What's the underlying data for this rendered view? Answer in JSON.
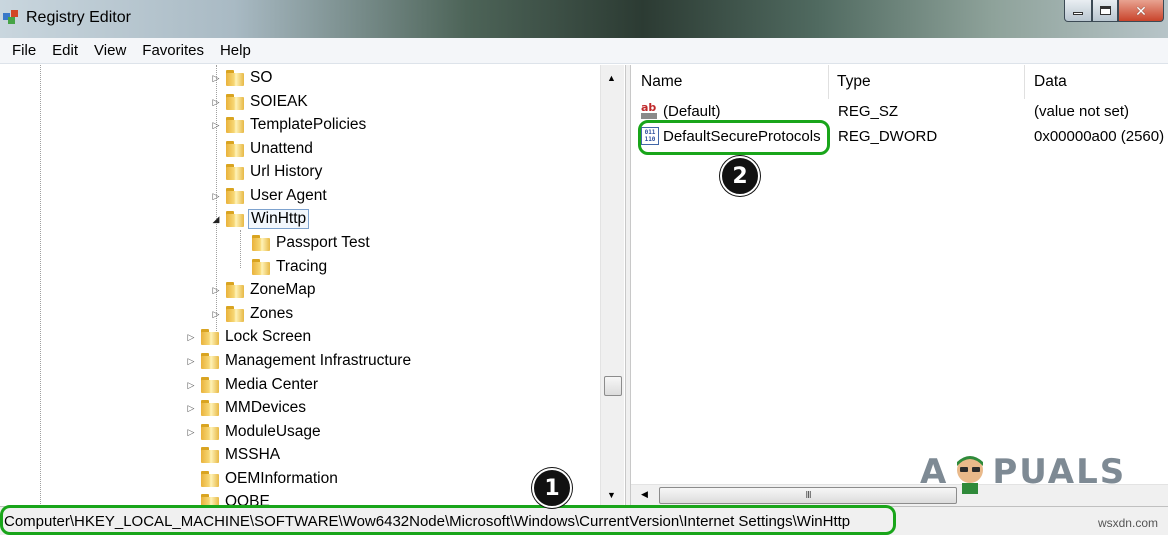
{
  "window": {
    "title": "Registry Editor",
    "controls": {
      "minimize": "—",
      "maximize": "□",
      "close": "✕"
    }
  },
  "menu": [
    "File",
    "Edit",
    "View",
    "Favorites",
    "Help"
  ],
  "tree": {
    "items": [
      {
        "label": "SO",
        "expander": "▷"
      },
      {
        "label": "SOIEAK",
        "expander": "▷"
      },
      {
        "label": "TemplatePolicies",
        "expander": "▷"
      },
      {
        "label": "Unattend",
        "expander": ""
      },
      {
        "label": "Url History",
        "expander": ""
      },
      {
        "label": "User Agent",
        "expander": "▷"
      },
      {
        "label": "WinHttp",
        "expander": "◢"
      },
      {
        "label": "Passport Test",
        "expander": ""
      },
      {
        "label": "Tracing",
        "expander": ""
      },
      {
        "label": "ZoneMap",
        "expander": "▷"
      },
      {
        "label": "Zones",
        "expander": "▷"
      },
      {
        "label": "Lock Screen",
        "expander": "▷"
      },
      {
        "label": "Management Infrastructure",
        "expander": "▷"
      },
      {
        "label": "Media Center",
        "expander": "▷"
      },
      {
        "label": "MMDevices",
        "expander": "▷"
      },
      {
        "label": "ModuleUsage",
        "expander": "▷"
      },
      {
        "label": "MSSHA",
        "expander": ""
      },
      {
        "label": "OEMInformation",
        "expander": ""
      },
      {
        "label": "OOBE",
        "expander": ""
      }
    ]
  },
  "values": {
    "columns": {
      "name": "Name",
      "type": "Type",
      "data": "Data"
    },
    "rows": [
      {
        "icon": "string-value-icon",
        "name": "(Default)",
        "type": "REG_SZ",
        "data": "(value not set)"
      },
      {
        "icon": "binary-value-icon",
        "name": "DefaultSecureProtocols",
        "type": "REG_DWORD",
        "data": "0x00000a00 (2560)"
      }
    ]
  },
  "scrollbar": {
    "thumb_grip": "III"
  },
  "statusbar": {
    "path": "Computer\\HKEY_LOCAL_MACHINE\\SOFTWARE\\Wow6432Node\\Microsoft\\Windows\\CurrentVersion\\Internet Settings\\WinHttp"
  },
  "annotations": {
    "step1": "1",
    "step2": "2"
  },
  "watermark": {
    "a": "A",
    "rest": "PUALS",
    "site": "wsxdn.com"
  },
  "colors": {
    "highlight": "#19a51a",
    "selection_border": "#7da2ce"
  }
}
